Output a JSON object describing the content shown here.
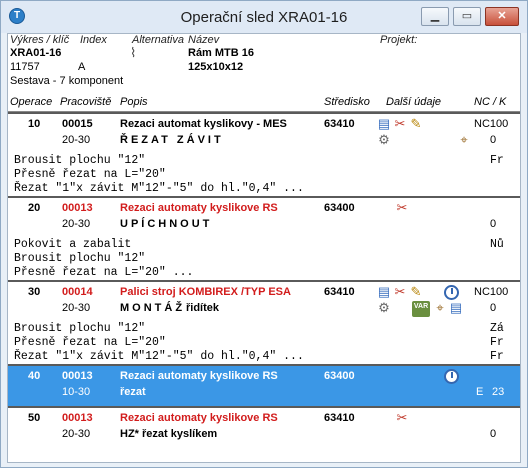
{
  "window": {
    "title": "Operační sled XRA01-16",
    "app_icon_letter": "T",
    "min": "▁",
    "max": "▭",
    "close": "✕"
  },
  "header": {
    "labels": {
      "vykres": "Výkres / klíč",
      "index": "Index",
      "alternativa": "Alternativa",
      "nazev": "Název",
      "projekt": "Projekt:"
    },
    "vykres_value": "XRA01-16",
    "index_value": "A",
    "code": "11757",
    "nazev_line1": "Rám MTB 16",
    "nazev_line2": "125x10x12",
    "sestava": "Sestava - 7 komponent"
  },
  "columns": [
    "Operace",
    "Pracoviště",
    "Popis",
    "Středisko",
    "Další údaje",
    "NC / K"
  ],
  "operations": [
    {
      "no": "10",
      "workplace": "00015",
      "desc": "Rezaci automat kyslikovy - MES",
      "red": false,
      "range": "20-30",
      "spaced_desc": "ŘEZAT ZÁVIT",
      "center": "63410",
      "nc": "NC100",
      "right2": "0",
      "notes": [
        "Brousit plochu \"12\"",
        "Přesně řezat na L=\"20\"",
        "Řezat \"1\"x závit M\"12\"-\"5\" do hl.\"0,4\" ..."
      ],
      "notes_right": [
        "Fr",
        "",
        ""
      ]
    },
    {
      "no": "20",
      "workplace": "00013",
      "desc": "Rezaci automaty kyslikove RS",
      "red": true,
      "range": "20-30",
      "spaced_desc": "UPÍCHNOUT",
      "center": "63400",
      "nc": "",
      "right2": "0",
      "notes": [
        "Pokovit a zabalit",
        "Brousit plochu \"12\"",
        "Přesně řezat na L=\"20\" ..."
      ],
      "notes_right": [
        "Nů",
        "",
        ""
      ]
    },
    {
      "no": "30",
      "workplace": "00014",
      "desc": "Palici stroj KOMBIREX /TYP ESA",
      "red": true,
      "range": "20-30",
      "spaced_desc": "MONTÁŽ",
      "extra_desc": "řidítek",
      "center": "63410",
      "nc": "NC100",
      "right2": "0",
      "notes": [
        "Brousit plochu \"12\"",
        "Přesně řezat na L=\"20\"",
        "Řezat \"1\"x závit M\"12\"-\"5\" do hl.\"0,4\" ..."
      ],
      "notes_right": [
        "Zá",
        "Fr",
        "Fr"
      ]
    },
    {
      "no": "40",
      "workplace": "00013",
      "desc": "Rezaci automaty kyslikove RS",
      "red": true,
      "range": "10-30",
      "spaced_desc": "",
      "extra_desc": "řezat",
      "center": "63400",
      "nc": "",
      "right2": "E",
      "right3": "23",
      "selected": true
    },
    {
      "no": "50",
      "workplace": "00013",
      "desc": "Rezaci automaty kyslikove RS",
      "red": true,
      "range": "20-30",
      "spaced_desc": "",
      "extra_desc": "HZ* řezat kyslíkem",
      "center": "63410",
      "nc": "",
      "right2": "0"
    }
  ],
  "icons": {
    "gear": "⚙",
    "tools": "✂",
    "pen": "✎",
    "doc": "▤",
    "var": "VAR",
    "stamp": "⌖"
  }
}
